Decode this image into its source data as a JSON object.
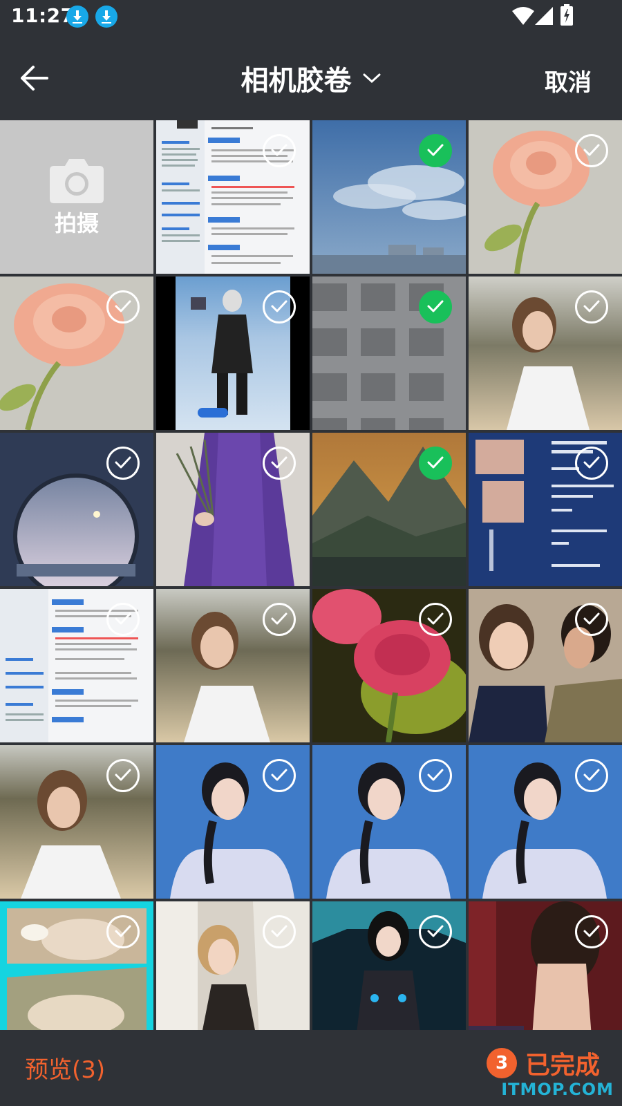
{
  "status_bar": {
    "time": "11:27",
    "icons": [
      "download-icon",
      "download-icon",
      "wifi-icon",
      "signal-icon",
      "battery-charging-icon"
    ]
  },
  "header": {
    "back_icon": "arrow-left-icon",
    "title": "相机胶卷",
    "title_icon": "chevron-down-icon",
    "cancel_label": "取消"
  },
  "camera_tile": {
    "icon": "camera-icon",
    "label": "拍摄"
  },
  "colors": {
    "background": "#2f3237",
    "accent": "#f2622e",
    "selected": "#19c05a",
    "watermark": "#24b3d6"
  },
  "photos": [
    {
      "selected": false,
      "subject": "resume document"
    },
    {
      "selected": true,
      "subject": "sky with clouds"
    },
    {
      "selected": false,
      "subject": "peach rose"
    },
    {
      "selected": false,
      "subject": "peach rose"
    },
    {
      "selected": false,
      "subject": "woman in snow"
    },
    {
      "selected": true,
      "subject": "building facade"
    },
    {
      "selected": false,
      "subject": "woman on beach"
    },
    {
      "selected": false,
      "subject": "round window"
    },
    {
      "selected": false,
      "subject": "woman in purple dress"
    },
    {
      "selected": true,
      "subject": "mountains at dusk"
    },
    {
      "selected": false,
      "subject": "invitation poster"
    },
    {
      "selected": false,
      "subject": "resume document"
    },
    {
      "selected": false,
      "subject": "woman on beach"
    },
    {
      "selected": false,
      "subject": "red roses"
    },
    {
      "selected": false,
      "subject": "couple"
    },
    {
      "selected": false,
      "subject": "woman on beach"
    },
    {
      "selected": false,
      "subject": "woman on blue"
    },
    {
      "selected": false,
      "subject": "woman on blue"
    },
    {
      "selected": false,
      "subject": "woman on blue"
    },
    {
      "selected": false,
      "subject": "flowers collage"
    },
    {
      "selected": false,
      "subject": "woman in white"
    },
    {
      "selected": false,
      "subject": "cosplay suit"
    },
    {
      "selected": false,
      "subject": "woman in dress"
    }
  ],
  "footer": {
    "preview_label": "预览(3)",
    "selected_count": "3",
    "done_label": "已完成"
  },
  "watermark": "ITMOP.COM"
}
